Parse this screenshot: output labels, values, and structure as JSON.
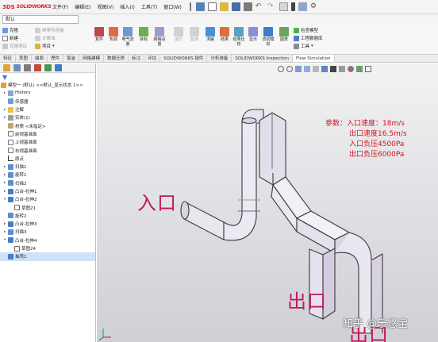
{
  "app": {
    "logo_ds": "3DS",
    "brand": "SOLIDWORKS",
    "menus": [
      "文件(F)",
      "编辑(E)",
      "视图(V)",
      "插入(I)",
      "工具(T)",
      "窗口(W)"
    ]
  },
  "config": {
    "value": "默认"
  },
  "ribbon": {
    "left_items": [
      "克隆",
      "新建",
      "克隆项目"
    ],
    "disabled_items": [
      "将零件连接",
      "计算域",
      "计算域"
    ],
    "project_label": "项目",
    "big_buttons": [
      "复件",
      "热源",
      "电气流量",
      "目标",
      "网格设置",
      "运行",
      "监测",
      "求解",
      "结果",
      "结果比较",
      "显示",
      "流动模拟",
      "图表",
      "屏幕显示"
    ],
    "right_items": [
      "检查模型",
      "工程数据库",
      "工具"
    ]
  },
  "tabs": [
    "特征",
    "草图",
    "曲面",
    "焊件",
    "钣金",
    "网格建模",
    "数据迁移",
    "标注",
    "评估",
    "SOLIDWORKS 插件",
    "分析准备",
    "SOLIDWORKS Inspection",
    "Flow Simulation"
  ],
  "tree": {
    "root": "模型一 (默认) <<默认_显示状态 1>>",
    "items": [
      "History",
      "传感器",
      "注解",
      "实体(1)",
      "材质 <未指定>",
      "前视基准面",
      "上视基准面",
      "右视基准面",
      "原点",
      "扫描1",
      "旋转1",
      "扫描2",
      "凸台-拉伸1",
      "凸台-拉伸2",
      "草图21",
      "旋转2",
      "凸台-拉伸3",
      "扫描3",
      "凸台-拉伸4",
      "草图24",
      "抽壳1"
    ]
  },
  "annotation": {
    "heading": "参数：",
    "lines": [
      "入口速度：18m/s",
      "出口速度16.5m/s",
      "入口负压4500Pa",
      "出口负压6000Pa"
    ]
  },
  "labels": {
    "inlet": "入口",
    "outlet1": "出口",
    "outlet2": "出口"
  },
  "watermark": "知乎 @乐悠宝",
  "colors": {
    "accent_red": "#d1121d",
    "label_magenta": "#c2185b",
    "pipe_face": "#e8e4ef",
    "pipe_edge": "#3a3a3a"
  }
}
